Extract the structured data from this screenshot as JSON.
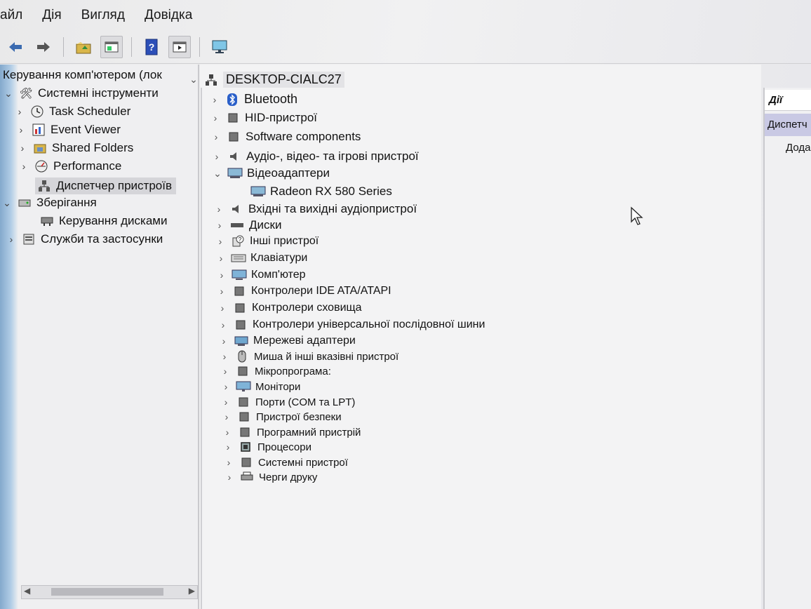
{
  "menu": [
    "айл",
    "Дія",
    "Вигляд",
    "Довідка"
  ],
  "toolbar_icons": [
    "back-arrow-icon",
    "forward-arrow-icon",
    "folder-up-icon",
    "properties-icon",
    "help-icon",
    "show-hide-icon",
    "monitor-icon"
  ],
  "tree": {
    "root": "Керування комп'ютером (лок",
    "system_tools": "Системні інструменти",
    "task_scheduler": "Task Scheduler",
    "event_viewer": "Event Viewer",
    "shared_folders": "Shared Folders",
    "performance": "Performance",
    "device_manager": "Диспетчер пристроїв",
    "storage": "Зберігання",
    "disk_management": "Керування дисками",
    "services": "Служби та застосунки"
  },
  "devices": {
    "computer_name": "DESKTOP-CIALC27",
    "items": [
      {
        "label": "Bluetooth",
        "expanded": false
      },
      {
        "label": "HID-пристрої",
        "expanded": false
      },
      {
        "label": "Software components",
        "expanded": false
      },
      {
        "label": "Аудіо-, відео- та ігрові пристрої",
        "expanded": false
      },
      {
        "label": "Відеоадаптери",
        "expanded": true
      },
      {
        "label": "Radeon RX 580 Series",
        "child": true
      },
      {
        "label": "Вхідні та вихідні аудіопристрої",
        "expanded": false
      },
      {
        "label": "Диски",
        "expanded": false
      },
      {
        "label": "Інші пристрої",
        "expanded": false
      },
      {
        "label": "Клавіатури",
        "expanded": false
      },
      {
        "label": "Комп'ютер",
        "expanded": false
      },
      {
        "label": "Контролери IDE ATA/ATAPI",
        "expanded": false
      },
      {
        "label": "Контролери сховища",
        "expanded": false
      },
      {
        "label": "Контролери універсальної послідовної шини",
        "expanded": false
      },
      {
        "label": "Мережеві адаптери",
        "expanded": false
      },
      {
        "label": "Миша й інші вказівні пристрої",
        "expanded": false
      },
      {
        "label": "Мікропрограма:",
        "expanded": false
      },
      {
        "label": "Монітори",
        "expanded": false
      },
      {
        "label": "Порти (COM та LPT)",
        "expanded": false
      },
      {
        "label": "Пристрої безпеки",
        "expanded": false
      },
      {
        "label": "Програмний пристрій",
        "expanded": false
      },
      {
        "label": "Процесори",
        "expanded": false
      },
      {
        "label": "Системні пристрої",
        "expanded": false
      },
      {
        "label": "Черги друку",
        "expanded": false
      }
    ]
  },
  "actions": {
    "header": "Дії",
    "selected": "Диспетч",
    "more": "Дода"
  }
}
